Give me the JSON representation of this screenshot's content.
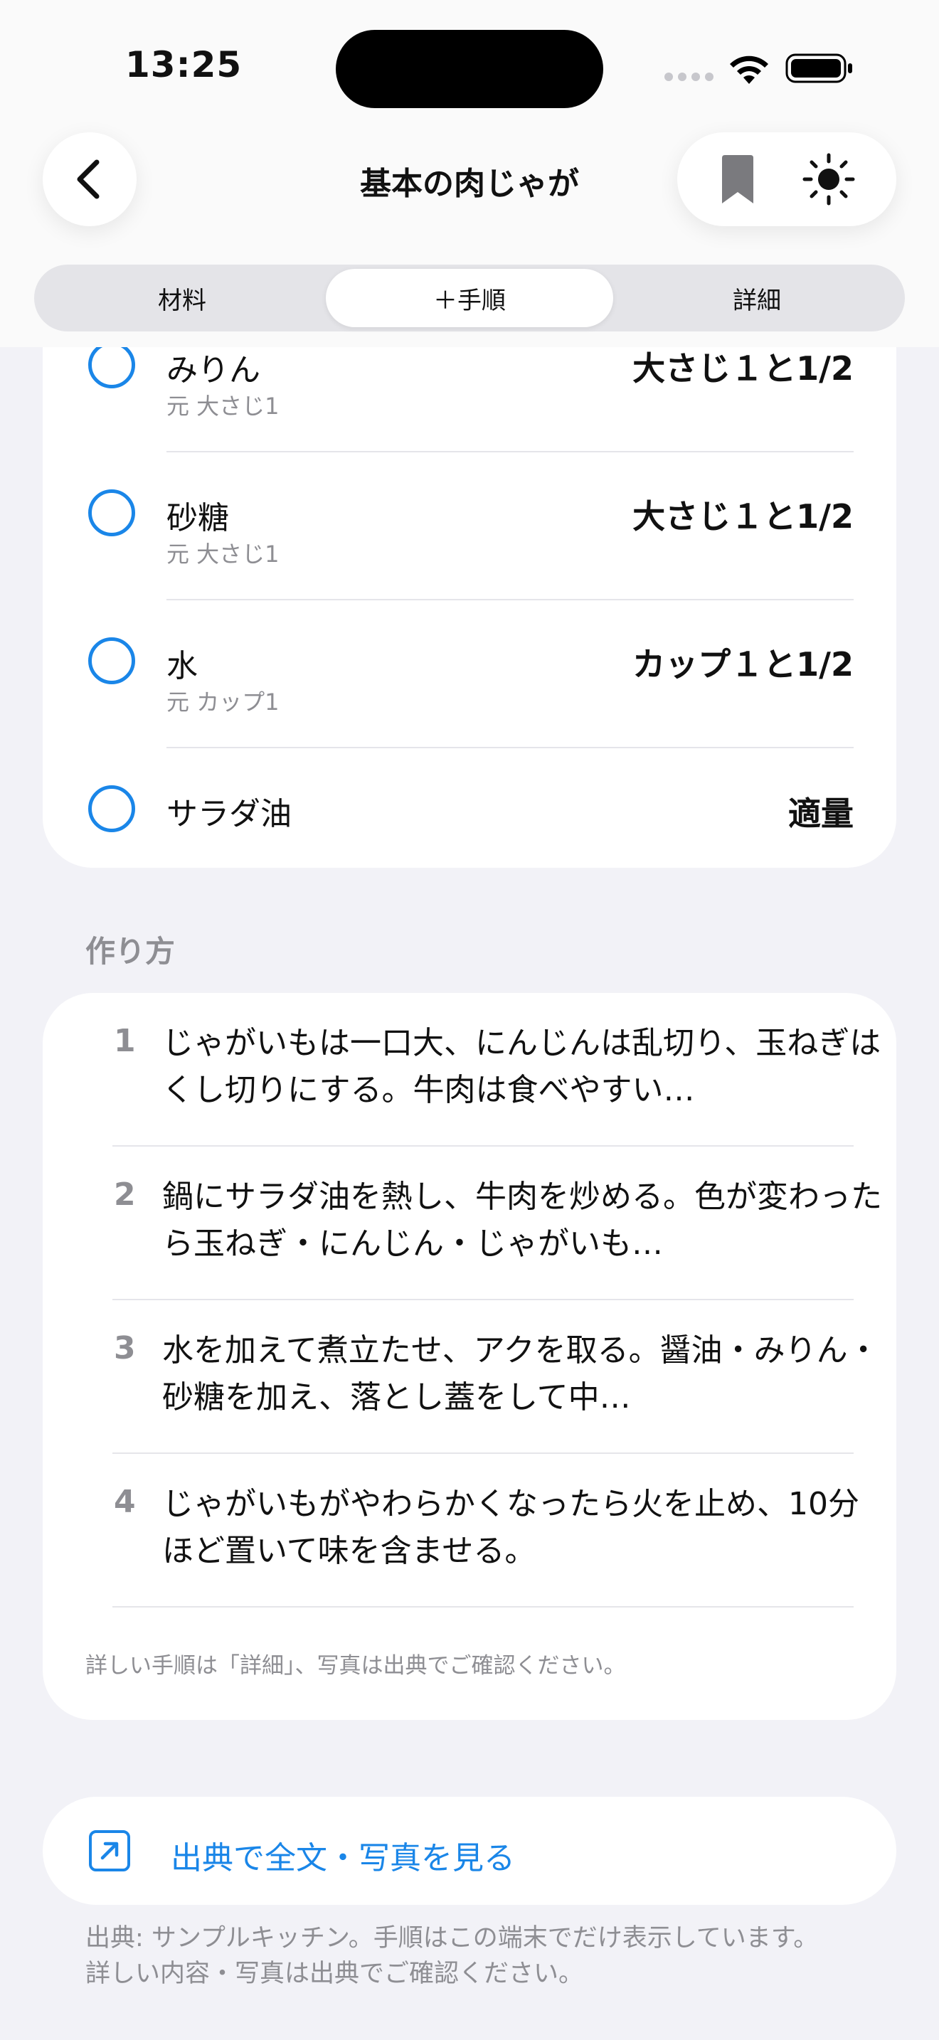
{
  "status_bar": {
    "time": "13:25"
  },
  "nav": {
    "title": "基本の肉じゃが"
  },
  "segments": [
    {
      "label": "材料"
    },
    {
      "label": "＋手順"
    },
    {
      "label": "詳細"
    }
  ],
  "ingredients": [
    {
      "name": "みりん",
      "original": "元 大さじ1",
      "amount": "大さじ１と1/2"
    },
    {
      "name": "砂糖",
      "original": "元 大さじ1",
      "amount": "大さじ１と1/2"
    },
    {
      "name": "水",
      "original": "元 カップ1",
      "amount": "カップ１と1/2"
    },
    {
      "name": "サラダ油",
      "original": "",
      "amount": "適量"
    }
  ],
  "steps_section": {
    "title": "作り方",
    "steps": [
      {
        "number": "1",
        "text": "じゃがいもは一口大、にんじんは乱切り、玉ねぎはくし切りにする。牛肉は食べやすい…"
      },
      {
        "number": "2",
        "text": "鍋にサラダ油を熱し、牛肉を炒める。色が変わったら玉ねぎ・にんじん・じゃがいも…"
      },
      {
        "number": "3",
        "text": "水を加えて煮立たせ、アクを取る。醤油・みりん・砂糖を加え、落とし蓋をして中…"
      },
      {
        "number": "4",
        "text": "じゃがいもがやわらかくなったら火を止め、10分ほど置いて味を含ませる。"
      }
    ],
    "note": "詳しい手順は「詳細」、写真は出典でご確認ください。"
  },
  "source_link": {
    "label": "出典で全文・写真を見る"
  },
  "footer": {
    "line1": "出典: サンプルキッチン。手順はこの端末でだけ表示しています。",
    "line2": "詳しい内容・写真は出典でご確認ください。"
  },
  "colors": {
    "accent": "#1a86e8",
    "secondary_text": "#8e8e93",
    "background": "#f2f2f7"
  }
}
